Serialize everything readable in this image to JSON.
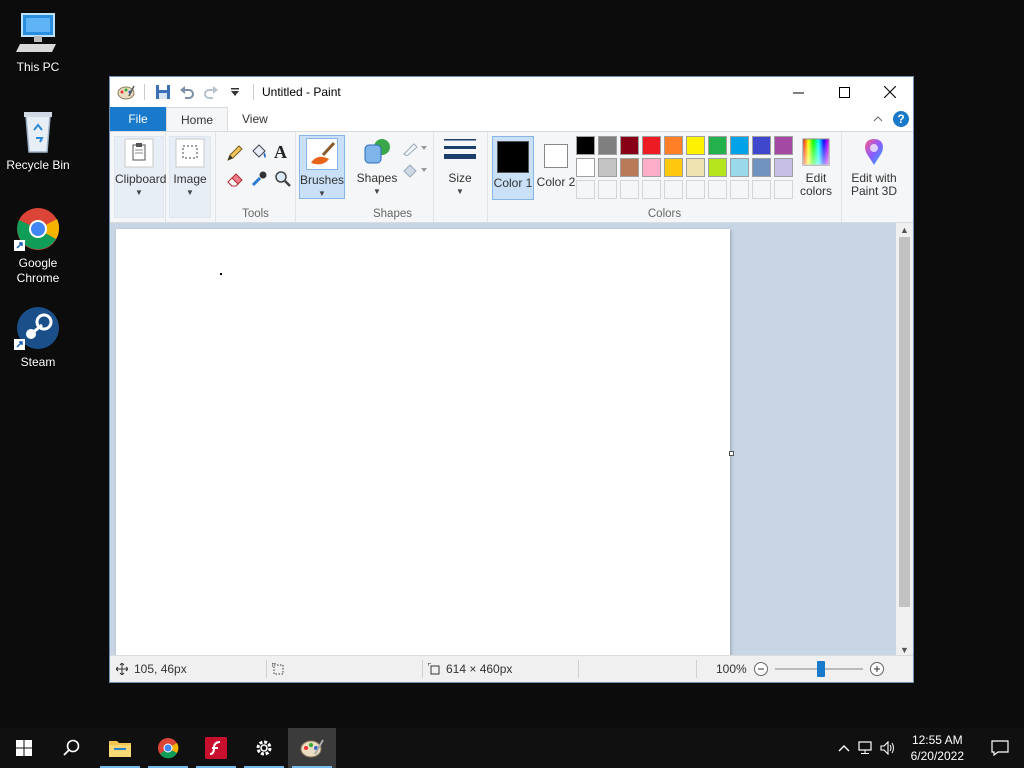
{
  "desktop": {
    "icons": [
      {
        "label": "This PC"
      },
      {
        "label": "Recycle Bin"
      },
      {
        "label": "Google Chrome"
      },
      {
        "label": "Steam"
      }
    ]
  },
  "window": {
    "title": "Untitled - Paint",
    "tabs": {
      "file": "File",
      "home": "Home",
      "view": "View"
    },
    "help": "?"
  },
  "ribbon": {
    "clipboard": "Clipboard",
    "image": "Image",
    "tools_group": "Tools",
    "brushes": "Brushes",
    "shapes": "Shapes",
    "shapes_group": "Shapes",
    "size": "Size",
    "color1": "Color 1",
    "color2": "Color 2",
    "edit_colors": "Edit colors",
    "edit_paint3d": "Edit with Paint 3D",
    "colors_group": "Colors",
    "palette_row1": [
      "#000000",
      "#7f7f7f",
      "#880015",
      "#ed1c24",
      "#ff7f27",
      "#fff200",
      "#22b14c",
      "#00a2e8",
      "#3f48cc",
      "#a349a4"
    ],
    "palette_row2": [
      "#ffffff",
      "#c3c3c3",
      "#b97a57",
      "#ffaec9",
      "#ffc90e",
      "#efe4b0",
      "#b5e61d",
      "#99d9ea",
      "#7092be",
      "#c8bfe7"
    ],
    "color1_value": "#000000",
    "color2_value": "#ffffff"
  },
  "status": {
    "cursor_pos": "105, 46px",
    "canvas_size": "614 × 460px",
    "zoom": "100%"
  },
  "taskbar": {
    "time": "12:55 AM",
    "date": "6/20/2022"
  }
}
